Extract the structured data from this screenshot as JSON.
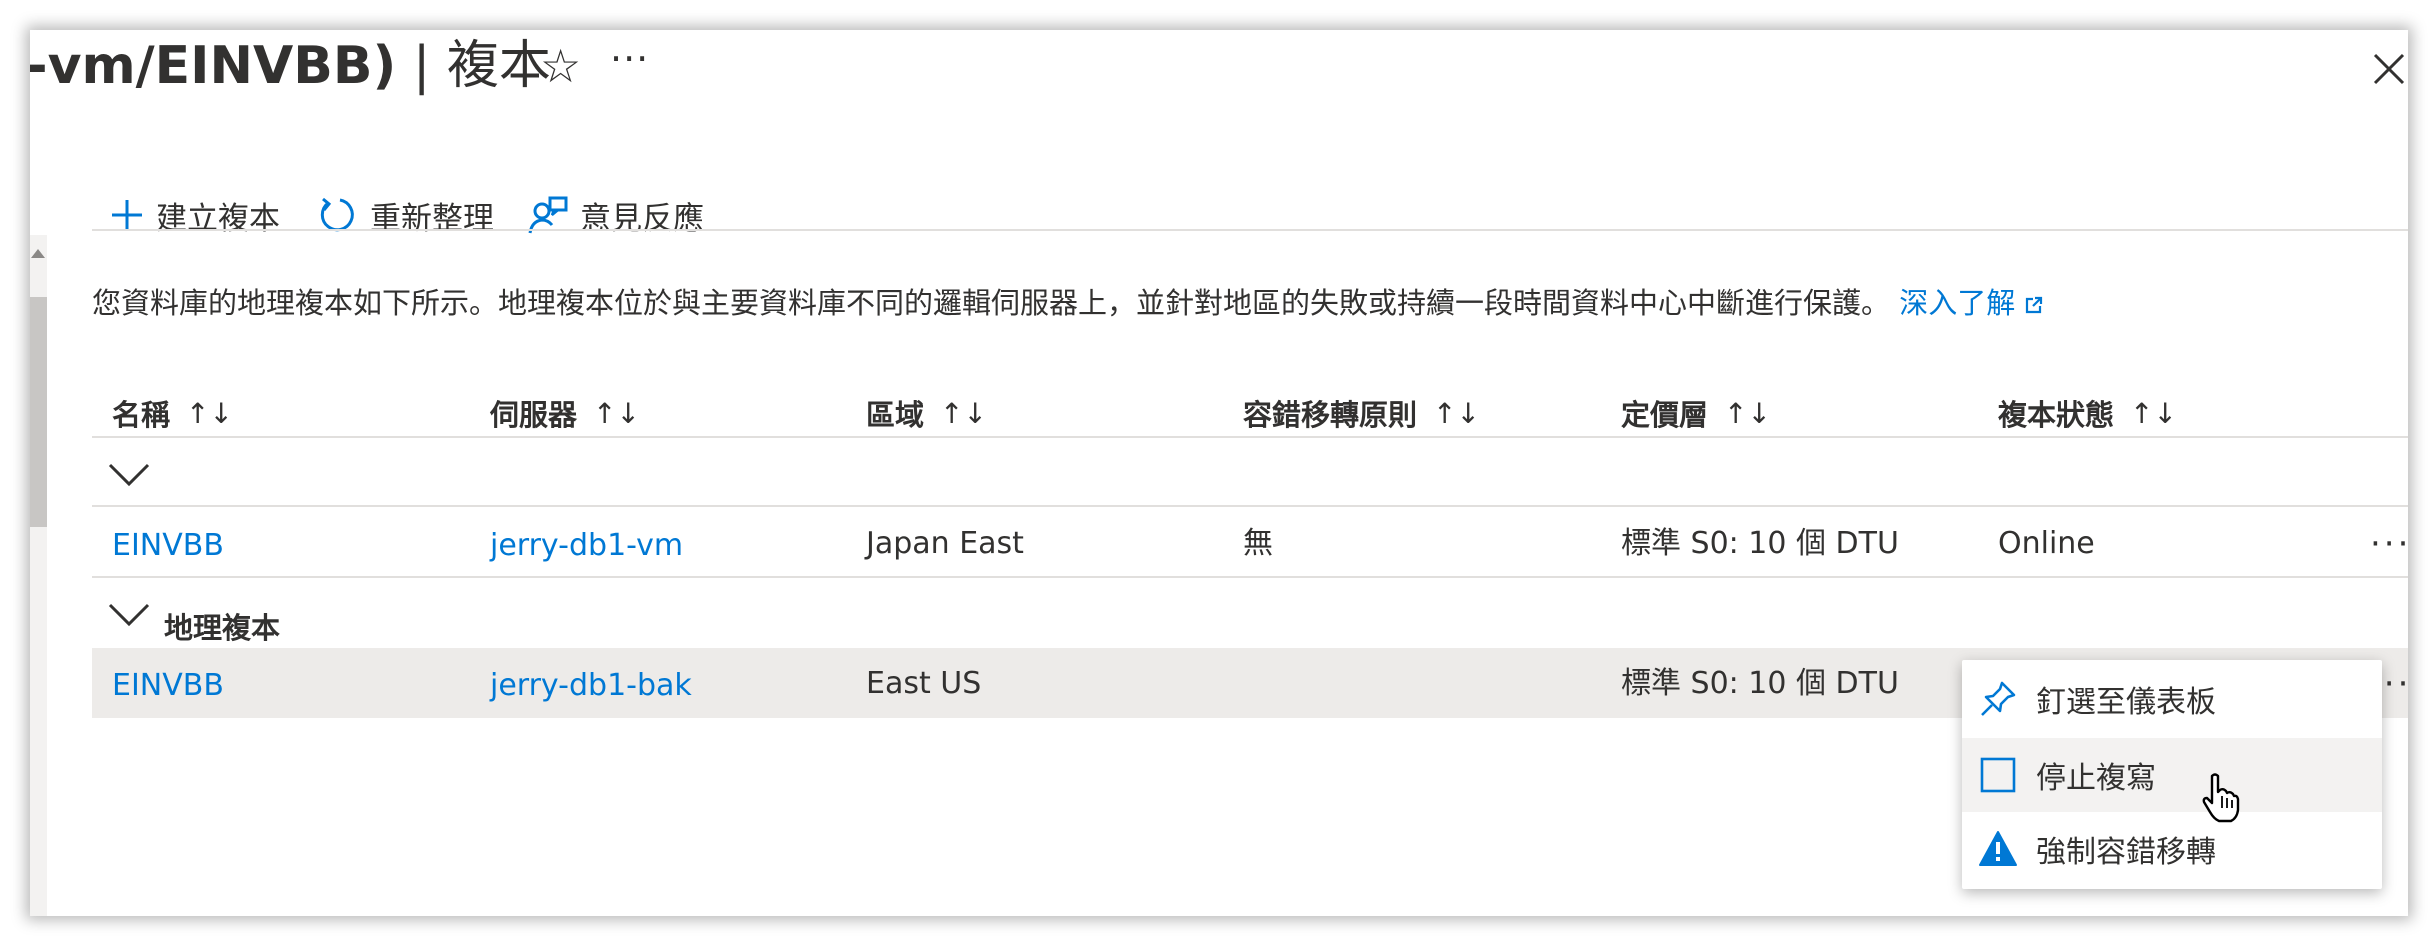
{
  "header": {
    "title_main": "-vm/EINVBB)",
    "title_sep": " | ",
    "title_page": "複本",
    "favorite_icon": "star-outline-icon",
    "more_label": "···",
    "close_icon": "close-icon"
  },
  "toolbar": {
    "create_label": "建立複本",
    "refresh_label": "重新整理",
    "feedback_label": "意見反應"
  },
  "description": {
    "text": "您資料庫的地理複本如下所示。地理複本位於與主要資料庫不同的邏輯伺服器上，並針對地區的失敗或持續一段時間資料中心中斷進行保護。",
    "link_label": "深入了解"
  },
  "table": {
    "sort_label": "↑↓",
    "columns": [
      "名稱",
      "伺服器",
      "區域",
      "容錯移轉原則",
      "定價層",
      "複本狀態"
    ],
    "groups": [
      {
        "label": "",
        "rows": [
          {
            "name": "EINVBB",
            "server": "jerry-db1-vm",
            "region": "Japan East",
            "failover": "無",
            "tier": "標準 S0: 10 個 DTU",
            "status": "Online",
            "more": "···"
          }
        ]
      },
      {
        "label": "地理複本",
        "rows": [
          {
            "name": "EINVBB",
            "server": "jerry-db1-bak",
            "region": "East US",
            "failover": "",
            "tier": "標準 S0: 10 個 DTU",
            "status": "",
            "more": "···"
          }
        ]
      }
    ]
  },
  "context_menu": {
    "items": [
      {
        "label": "釘選至儀表板",
        "icon": "pin-icon"
      },
      {
        "label": "停止複寫",
        "icon": "stop-square-icon"
      },
      {
        "label": "強制容錯移轉",
        "icon": "warning-icon"
      }
    ]
  },
  "colors": {
    "link": "#0078d4",
    "text": "#323130",
    "row_highlight": "#edebe9",
    "border": "#e1dfdd"
  }
}
